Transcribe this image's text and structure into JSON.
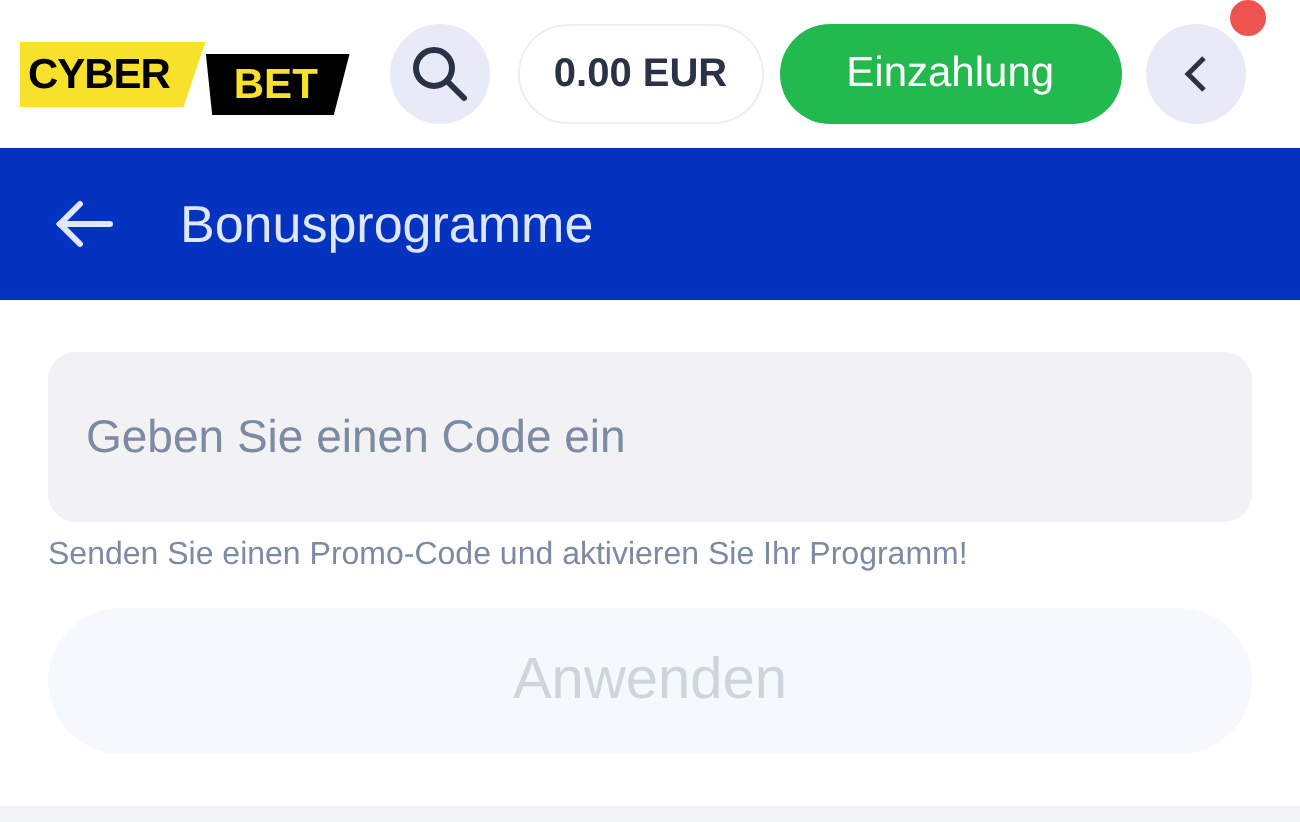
{
  "header": {
    "logo": {
      "part_1": "CYBER",
      "part_2": "BET"
    },
    "balance": "0.00 EUR",
    "deposit_button": "Einzahlung",
    "notification": true
  },
  "title_bar": {
    "title": "Bonusprogramme"
  },
  "promo_form": {
    "code_field": {
      "placeholder": "Geben Sie einen Code ein"
    },
    "hint": "Senden Sie einen Promo-Code und aktivieren Sie Ihr Programm!",
    "apply_button": {
      "label": "Anwenden",
      "disabled": true
    }
  }
}
